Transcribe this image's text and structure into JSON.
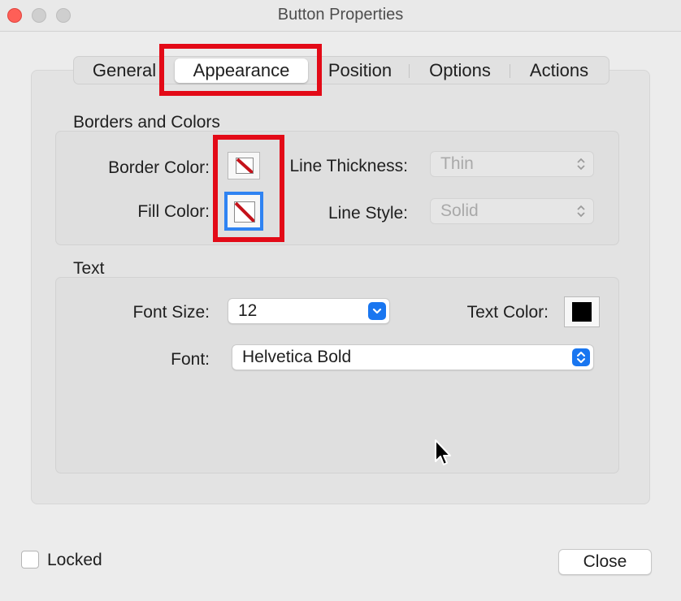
{
  "window": {
    "title": "Button Properties"
  },
  "tabs": [
    {
      "label": "General",
      "selected": false
    },
    {
      "label": "Appearance",
      "selected": true
    },
    {
      "label": "Position",
      "selected": false
    },
    {
      "label": "Options",
      "selected": false
    },
    {
      "label": "Actions",
      "selected": false
    }
  ],
  "borders_colors": {
    "section_label": "Borders and Colors",
    "border_color_label": "Border Color:",
    "border_color_icon": "no-color-swatch-icon",
    "fill_color_label": "Fill Color:",
    "fill_color_icon": "no-color-swatch-icon",
    "line_thickness_label": "Line Thickness:",
    "line_thickness_value": "Thin",
    "line_style_label": "Line Style:",
    "line_style_value": "Solid"
  },
  "text": {
    "section_label": "Text",
    "font_size_label": "Font Size:",
    "font_size_value": "12",
    "text_color_label": "Text Color:",
    "text_color_value": "#000000",
    "font_label": "Font:",
    "font_value": "Helvetica Bold"
  },
  "footer": {
    "locked_label": "Locked",
    "locked_checked": false,
    "close_label": "Close"
  },
  "colors": {
    "highlight": "#e30a17",
    "focus_ring": "#2f83f2",
    "accent": "#1976f0"
  }
}
